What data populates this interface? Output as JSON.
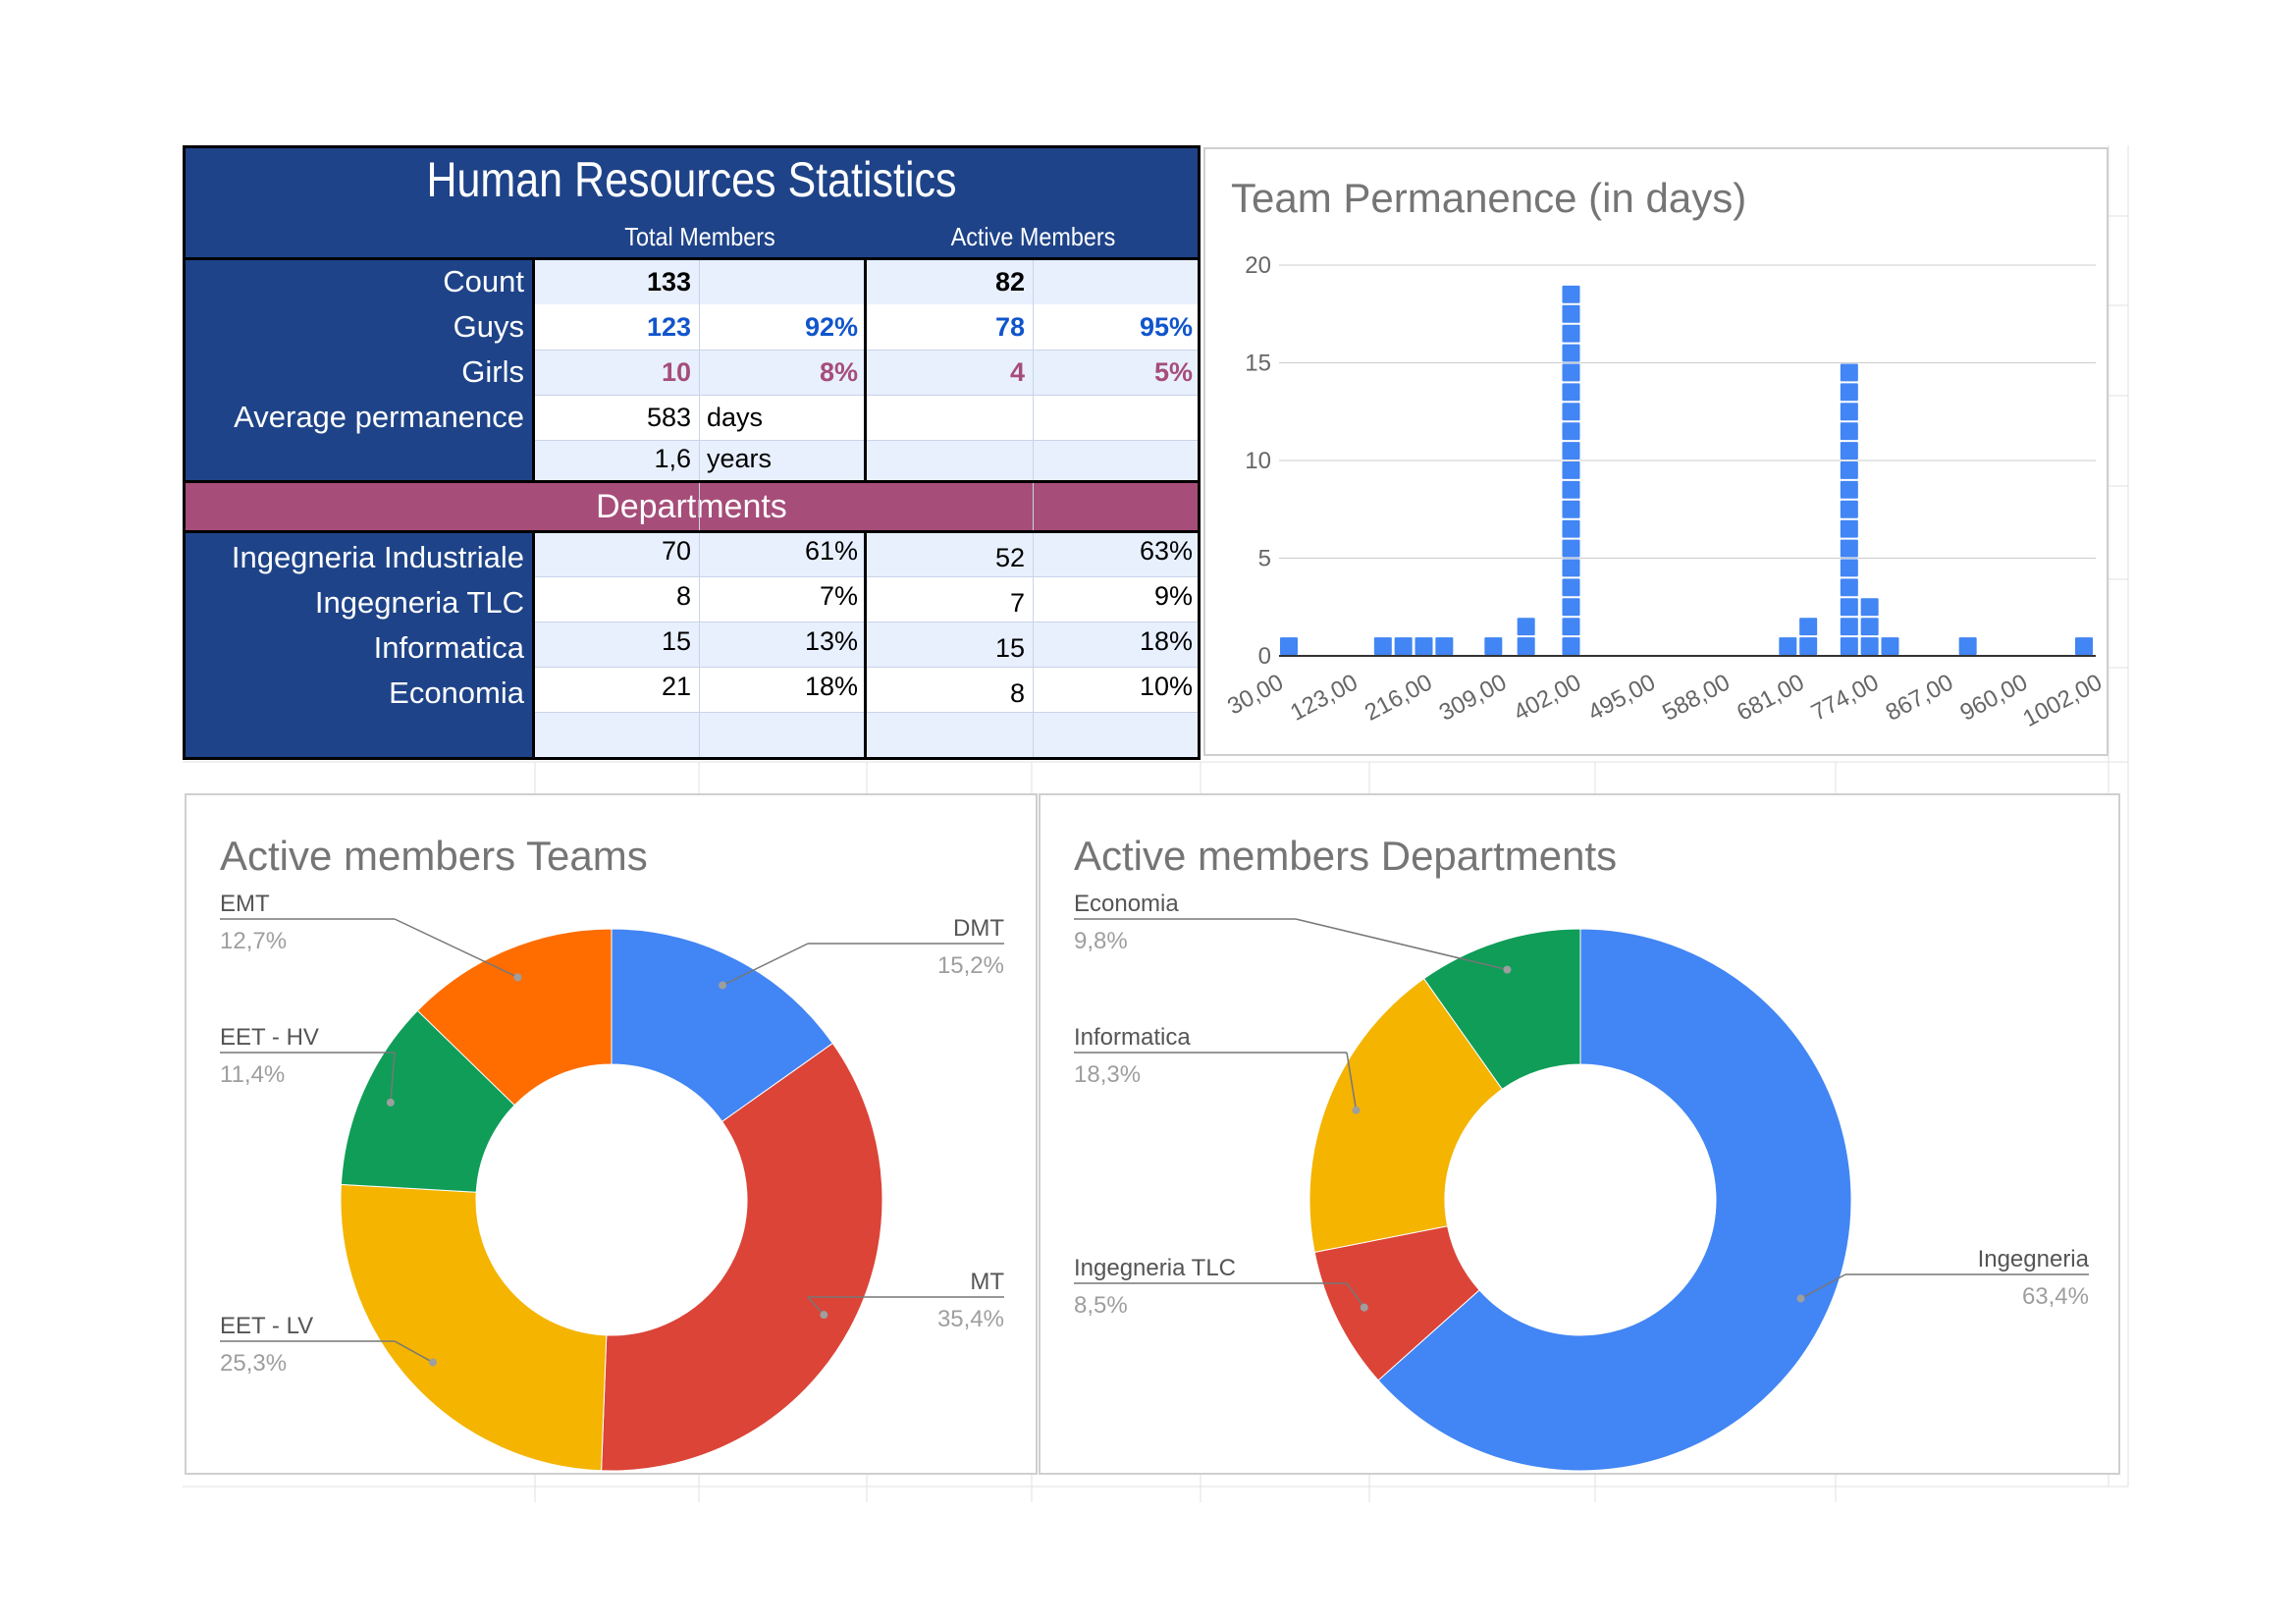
{
  "table": {
    "title": "Human Resources Statistics",
    "headers": {
      "total": "Total Members",
      "active": "Active Members"
    },
    "stats": {
      "count": {
        "label": "Count",
        "total": "133",
        "active": "82"
      },
      "guys": {
        "label": "Guys",
        "total": "123",
        "total_pct": "92%",
        "active": "78",
        "active_pct": "95%"
      },
      "girls": {
        "label": "Girls",
        "total": "10",
        "total_pct": "8%",
        "active": "4",
        "active_pct": "5%"
      },
      "avg": {
        "label": "Average permanence",
        "days": "583",
        "days_unit": "days",
        "years": "1,6",
        "years_unit": "years"
      }
    },
    "departments_title": "Departments",
    "departments": [
      {
        "name": "Ingegneria Industriale",
        "total": "70",
        "total_pct": "61%",
        "active": "52",
        "active_pct": "63%"
      },
      {
        "name": "Ingegneria TLC",
        "total": "8",
        "total_pct": "7%",
        "active": "7",
        "active_pct": "9%"
      },
      {
        "name": "Informatica",
        "total": "15",
        "total_pct": "13%",
        "active": "15",
        "active_pct": "18%"
      },
      {
        "name": "Economia",
        "total": "21",
        "total_pct": "18%",
        "active": "8",
        "active_pct": "10%"
      }
    ],
    "colors": {
      "navy": "#1e4388",
      "plum": "#a64d79",
      "blue_text": "#1155cc",
      "shade": "#e8f0fe"
    }
  },
  "chart_data": [
    {
      "type": "bar",
      "title": "Team Permanence (in days)",
      "x_tick_labels": [
        "30,00",
        "123,00",
        "216,00",
        "309,00",
        "402,00",
        "495,00",
        "588,00",
        "681,00",
        "774,00",
        "867,00",
        "960,00",
        "1002,00"
      ],
      "y_ticks": [
        0,
        5,
        10,
        15,
        20
      ],
      "ylim": [
        0,
        20
      ],
      "xlim": [
        30,
        1002
      ],
      "color": "#4285f4",
      "bins": [
        {
          "x": 30,
          "count": 1
        },
        {
          "x": 145,
          "count": 1
        },
        {
          "x": 170,
          "count": 1
        },
        {
          "x": 195,
          "count": 1
        },
        {
          "x": 220,
          "count": 1
        },
        {
          "x": 280,
          "count": 1
        },
        {
          "x": 320,
          "count": 2
        },
        {
          "x": 375,
          "count": 19
        },
        {
          "x": 640,
          "count": 1
        },
        {
          "x": 665,
          "count": 2
        },
        {
          "x": 715,
          "count": 15
        },
        {
          "x": 740,
          "count": 3
        },
        {
          "x": 765,
          "count": 1
        },
        {
          "x": 860,
          "count": 1
        },
        {
          "x": 1002,
          "count": 1
        }
      ],
      "grid": true
    },
    {
      "type": "pie",
      "title": "Active members Teams",
      "donut": true,
      "slices": [
        {
          "name": "DMT",
          "value": 15.2,
          "label": "15,2%",
          "color": "#4285f4"
        },
        {
          "name": "MT",
          "value": 35.4,
          "label": "35,4%",
          "color": "#db4437"
        },
        {
          "name": "EET - LV",
          "value": 25.3,
          "label": "25,3%",
          "color": "#f4b400"
        },
        {
          "name": "EET - HV",
          "value": 11.4,
          "label": "11,4%",
          "color": "#0f9d58"
        },
        {
          "name": "EMT",
          "value": 12.7,
          "label": "12,7%",
          "color": "#ff6d00"
        }
      ]
    },
    {
      "type": "pie",
      "title": "Active members Departments",
      "donut": true,
      "slices": [
        {
          "name": "Ingegneria",
          "value": 63.4,
          "label": "63,4%",
          "color": "#4285f4"
        },
        {
          "name": "Ingegneria TLC",
          "value": 8.5,
          "label": "8,5%",
          "color": "#db4437"
        },
        {
          "name": "Informatica",
          "value": 18.3,
          "label": "18,3%",
          "color": "#f4b400"
        },
        {
          "name": "Economia",
          "value": 9.8,
          "label": "9,8%",
          "color": "#0f9d58"
        }
      ]
    }
  ]
}
